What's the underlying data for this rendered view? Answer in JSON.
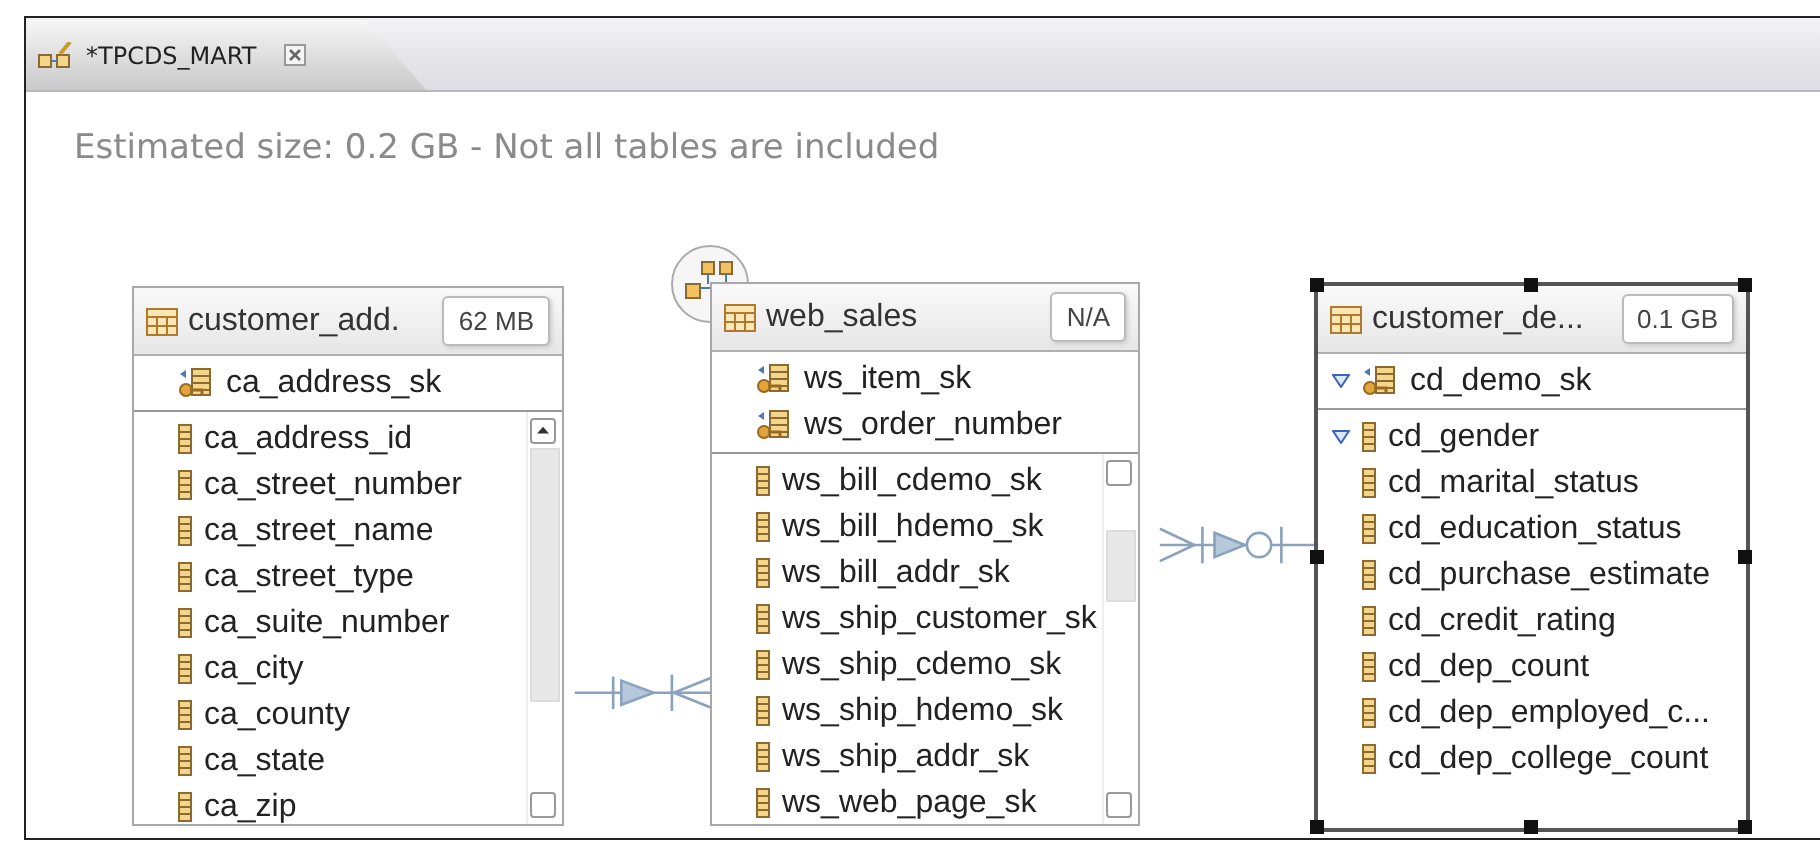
{
  "editor_tab": {
    "title": "*TPCDS_MART"
  },
  "status_text": "Estimated size: 0.2 GB - Not all tables are included",
  "tables": [
    {
      "name": "customer_add.",
      "size": "62 MB",
      "selected": false,
      "scrollable": true,
      "key_columns": [
        {
          "name": "ca_address_sk",
          "flagged": false
        }
      ],
      "columns": [
        {
          "name": "ca_address_id",
          "flagged": false
        },
        {
          "name": "ca_street_number",
          "flagged": false
        },
        {
          "name": "ca_street_name",
          "flagged": false
        },
        {
          "name": "ca_street_type",
          "flagged": false
        },
        {
          "name": "ca_suite_number",
          "flagged": false
        },
        {
          "name": "ca_city",
          "flagged": false
        },
        {
          "name": "ca_county",
          "flagged": false
        },
        {
          "name": "ca_state",
          "flagged": false
        },
        {
          "name": "ca_zip",
          "flagged": false
        }
      ]
    },
    {
      "name": "web_sales",
      "size": "N/A",
      "selected": false,
      "scrollable": true,
      "key_columns": [
        {
          "name": "ws_item_sk",
          "flagged": false
        },
        {
          "name": "ws_order_number",
          "flagged": false
        }
      ],
      "columns": [
        {
          "name": "ws_bill_cdemo_sk",
          "flagged": false
        },
        {
          "name": "ws_bill_hdemo_sk",
          "flagged": false
        },
        {
          "name": "ws_bill_addr_sk",
          "flagged": false
        },
        {
          "name": "ws_ship_customer_sk",
          "flagged": false
        },
        {
          "name": "ws_ship_cdemo_sk",
          "flagged": false
        },
        {
          "name": "ws_ship_hdemo_sk",
          "flagged": false
        },
        {
          "name": "ws_ship_addr_sk",
          "flagged": false
        },
        {
          "name": "ws_web_page_sk",
          "flagged": false
        }
      ]
    },
    {
      "name": "customer_de...",
      "size": "0.1 GB",
      "selected": true,
      "scrollable": false,
      "key_columns": [
        {
          "name": "cd_demo_sk",
          "flagged": true
        }
      ],
      "columns": [
        {
          "name": "cd_gender",
          "flagged": true
        },
        {
          "name": "cd_marital_status",
          "flagged": false
        },
        {
          "name": "cd_education_status",
          "flagged": false
        },
        {
          "name": "cd_purchase_estimate",
          "flagged": false
        },
        {
          "name": "cd_credit_rating",
          "flagged": false
        },
        {
          "name": "cd_dep_count",
          "flagged": false
        },
        {
          "name": "cd_dep_employed_c...",
          "flagged": false
        },
        {
          "name": "cd_dep_college_count",
          "flagged": false
        }
      ]
    }
  ]
}
